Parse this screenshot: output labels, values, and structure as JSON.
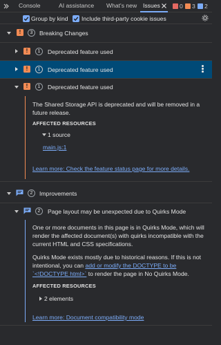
{
  "tabs": [
    {
      "label": "Console"
    },
    {
      "label": "AI assistance"
    },
    {
      "label": "What's new"
    },
    {
      "label": "Issues"
    }
  ],
  "counts": {
    "errors": "0",
    "warnings": "3",
    "info": "2"
  },
  "toolbar": {
    "group_by_kind": "Group by kind",
    "include_third_party": "Include third-party cookie issues"
  },
  "breaking": {
    "title": "Breaking Changes",
    "count": "3",
    "issues": [
      {
        "count": "1",
        "title": "Deprecated feature used"
      },
      {
        "count": "1",
        "title": "Deprecated feature used"
      },
      {
        "count": "1",
        "title": "Deprecated feature used"
      }
    ],
    "detail": {
      "message": "The Shared Storage API is deprecated and will be removed in a future release.",
      "affected_heading": "AFFECTED RESOURCES",
      "source_count": "1 source",
      "source_link": "main.js:1",
      "learn_more": "Learn more: Check the feature status page for more details."
    }
  },
  "improvements": {
    "title": "Improvements",
    "count": "2",
    "issue": {
      "count": "2",
      "title": "Page layout may be unexpected due to Quirks Mode",
      "para1": "One or more documents in this page is in Quirks Mode, which will render the affected document(s) with quirks incompatible with the current HTML and CSS specifications.",
      "para2_before": "Quirks Mode exists mostly due to historical reasons. If this is not intentional, you can ",
      "para2_link": "add or modify the DOCTYPE to be `<!DOCTYPE html>`",
      "para2_after": " to render the page in No Quirks Mode.",
      "affected_heading": "AFFECTED RESOURCES",
      "elements": "2 elements",
      "learn_more": "Learn more: Document compatibility mode"
    }
  },
  "colors": {
    "warning": "#f28b54",
    "accent": "#7cacf8",
    "selected": "#004a77",
    "background": "#292a2d"
  }
}
